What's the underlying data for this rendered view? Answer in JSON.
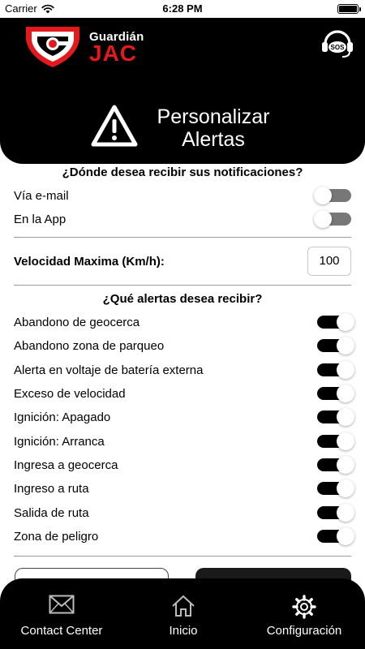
{
  "status_bar": {
    "carrier": "Carrier",
    "time": "6:28 PM"
  },
  "header": {
    "brand_top": "Guardián",
    "brand_bottom": "JAC",
    "sos_label": "SOS",
    "icons": {
      "sos": "headset-sos-icon",
      "warning": "warning-triangle-icon"
    },
    "colors": {
      "brand_red": "#e3191d",
      "header_bg": "#000000"
    }
  },
  "title": {
    "line1": "Personalizar",
    "line2": "Alertas"
  },
  "notifications": {
    "question": "¿Dónde desea recibir sus notificaciones?",
    "options": [
      {
        "label": "Vía e-mail",
        "enabled": false
      },
      {
        "label": "En la App",
        "enabled": false
      }
    ]
  },
  "speed": {
    "label": "Velocidad Maxima (Km/h):",
    "value": "100"
  },
  "alerts": {
    "question": "¿Qué alertas desea recibir?",
    "items": [
      {
        "label": "Abandono de geocerca",
        "enabled": true
      },
      {
        "label": "Abandono zona de parqueo",
        "enabled": true
      },
      {
        "label": "Alerta en voltaje de batería externa",
        "enabled": true
      },
      {
        "label": "Exceso de velocidad",
        "enabled": true
      },
      {
        "label": "Ignición: Apagado",
        "enabled": true
      },
      {
        "label": "Ignición: Arranca",
        "enabled": true
      },
      {
        "label": "Ingresa a geocerca",
        "enabled": true
      },
      {
        "label": "Ingreso a ruta",
        "enabled": true
      },
      {
        "label": "Salida de ruta",
        "enabled": true
      },
      {
        "label": "Zona de peligro",
        "enabled": true
      }
    ]
  },
  "tabs": [
    {
      "label": "Contact Center",
      "icon": "envelope-icon"
    },
    {
      "label": "Inicio",
      "icon": "home-icon"
    },
    {
      "label": "Configuración",
      "icon": "gear-icon"
    }
  ]
}
